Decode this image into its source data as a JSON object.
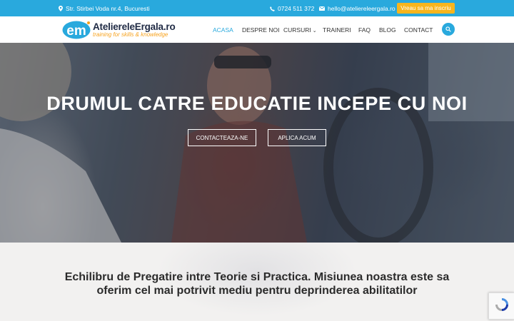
{
  "topbar": {
    "address": "Str. Stirbei Voda nr.4, Bucuresti",
    "phone": "0724 511 372",
    "email": "hello@ateliereleergala.ro",
    "cta_label": "Vreau sa ma inscriu"
  },
  "logo": {
    "name": "AteliereleErgala.ro",
    "tagline": "training for skills & knowledge"
  },
  "nav": {
    "items": [
      {
        "label": "ACASA",
        "active": true
      },
      {
        "label": "DESPRE NOI",
        "active": false
      },
      {
        "label": "CURSURI",
        "active": false,
        "has_dropdown": true
      },
      {
        "label": "TRAINERI",
        "active": false
      },
      {
        "label": "FAQ",
        "active": false
      },
      {
        "label": "BLOG",
        "active": false
      },
      {
        "label": "CONTACT",
        "active": false
      }
    ],
    "search_icon": "search-icon"
  },
  "hero": {
    "title": "DRUMUL CATRE EDUCATIE INCEPE CU NOI",
    "buttons": [
      {
        "label": "CONTACTEAZA-NE"
      },
      {
        "label": "APLICA ACUM"
      }
    ]
  },
  "mission": {
    "text": "Echilibru de Pregatire intre Teorie si Practica. Misiunea noastra este sa oferim cel mai potrivit mediu pentru deprinderea abilitatilor"
  },
  "colors": {
    "accent": "#29a9dd",
    "cta": "#f7b51d",
    "brand_dark": "#1f2a44"
  }
}
